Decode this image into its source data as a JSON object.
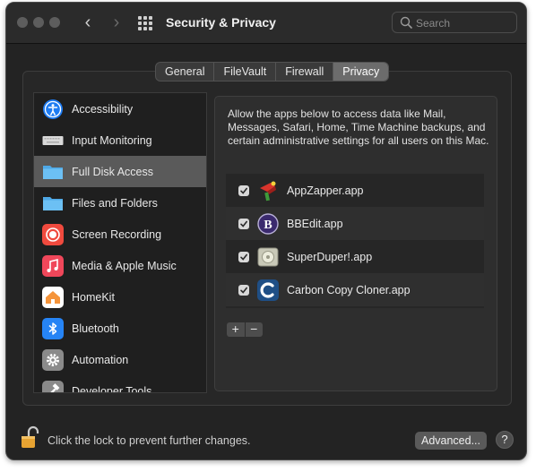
{
  "window": {
    "title": "Security & Privacy",
    "search": {
      "placeholder": "Search",
      "value": ""
    }
  },
  "tabs": [
    {
      "label": "General",
      "active": false
    },
    {
      "label": "FileVault",
      "active": false
    },
    {
      "label": "Firewall",
      "active": false
    },
    {
      "label": "Privacy",
      "active": true
    }
  ],
  "sidebar": {
    "items": [
      {
        "label": "Accessibility",
        "icon": "accessibility-icon",
        "color": "#1e7cf2"
      },
      {
        "label": "Input Monitoring",
        "icon": "keyboard-icon",
        "color": "#d9d9d9"
      },
      {
        "label": "Full Disk Access",
        "icon": "folder-icon",
        "color": "#5ab7f0",
        "selected": true
      },
      {
        "label": "Files and Folders",
        "icon": "folder-icon",
        "color": "#5ab7f0"
      },
      {
        "label": "Screen Recording",
        "icon": "record-icon",
        "color": "#f04a3e"
      },
      {
        "label": "Media & Apple Music",
        "icon": "music-icon",
        "color": "#f0475a"
      },
      {
        "label": "HomeKit",
        "icon": "home-icon",
        "color": "#f5943a"
      },
      {
        "label": "Bluetooth",
        "icon": "bluetooth-icon",
        "color": "#2684f5"
      },
      {
        "label": "Automation",
        "icon": "gear-icon",
        "color": "#8a8a8a"
      },
      {
        "label": "Developer Tools",
        "icon": "hammer-icon",
        "color": "#8a8a8a"
      }
    ]
  },
  "main": {
    "description": "Allow the apps below to access data like Mail, Messages, Safari, Home, Time Machine backups, and certain administrative settings for all users on this Mac.",
    "apps": [
      {
        "name": "AppZapper.app",
        "checked": true,
        "icon": "appzapper-icon"
      },
      {
        "name": "BBEdit.app",
        "checked": true,
        "icon": "bbedit-icon"
      },
      {
        "name": "SuperDuper!.app",
        "checked": true,
        "icon": "superduper-icon"
      },
      {
        "name": "Carbon Copy Cloner.app",
        "checked": true,
        "icon": "ccc-icon"
      }
    ],
    "add_label": "+",
    "remove_label": "−"
  },
  "footer": {
    "lock_text": "Click the lock to prevent further changes.",
    "advanced_label": "Advanced...",
    "help_label": "?"
  }
}
